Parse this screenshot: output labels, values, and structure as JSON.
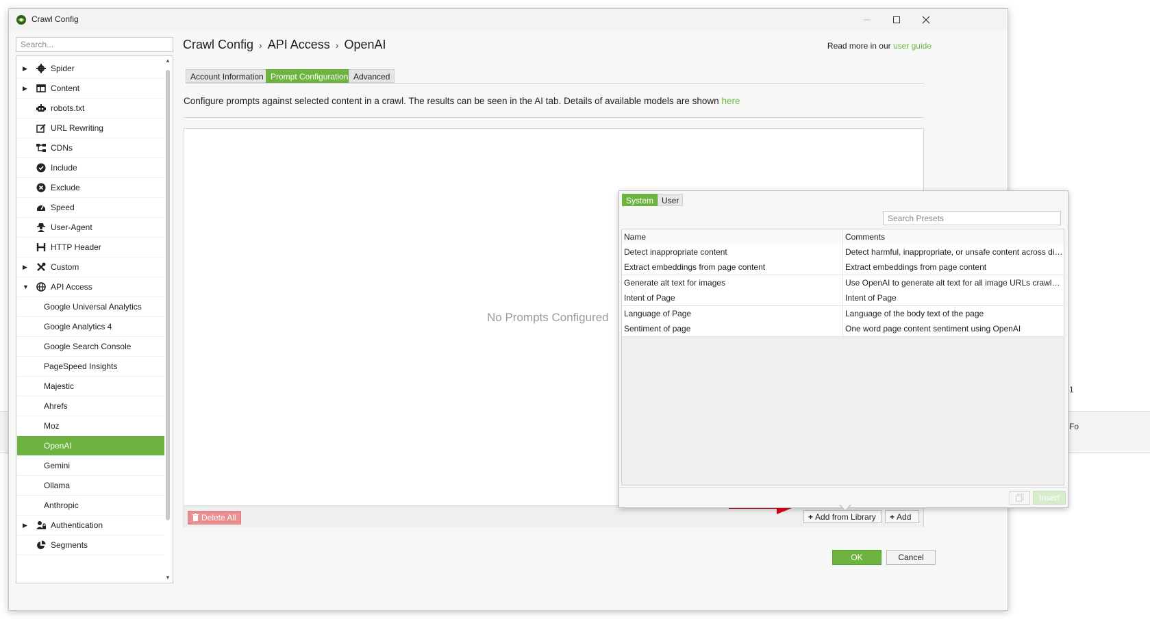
{
  "window": {
    "title": "Crawl Config"
  },
  "sidebar": {
    "search_placeholder": "Search...",
    "items": [
      {
        "label": "Spider",
        "icon": "gear-icon",
        "expandable": true,
        "expanded": false,
        "child": false,
        "selected": false
      },
      {
        "label": "Content",
        "icon": "columns-icon",
        "expandable": true,
        "expanded": false,
        "child": false,
        "selected": false
      },
      {
        "label": "robots.txt",
        "icon": "robot-icon",
        "expandable": false,
        "child": false,
        "selected": false
      },
      {
        "label": "URL Rewriting",
        "icon": "edit-icon",
        "expandable": false,
        "child": false,
        "selected": false
      },
      {
        "label": "CDNs",
        "icon": "network-icon",
        "expandable": false,
        "child": false,
        "selected": false
      },
      {
        "label": "Include",
        "icon": "check-circle-icon",
        "expandable": false,
        "child": false,
        "selected": false
      },
      {
        "label": "Exclude",
        "icon": "x-circle-icon",
        "expandable": false,
        "child": false,
        "selected": false
      },
      {
        "label": "Speed",
        "icon": "gauge-icon",
        "expandable": false,
        "child": false,
        "selected": false
      },
      {
        "label": "User-Agent",
        "icon": "user-secret-icon",
        "expandable": false,
        "child": false,
        "selected": false
      },
      {
        "label": "HTTP Header",
        "icon": "header-icon",
        "expandable": false,
        "child": false,
        "selected": false
      },
      {
        "label": "Custom",
        "icon": "tools-icon",
        "expandable": true,
        "expanded": false,
        "child": false,
        "selected": false
      },
      {
        "label": "API Access",
        "icon": "globe-icon",
        "expandable": true,
        "expanded": true,
        "child": false,
        "selected": false
      },
      {
        "label": "Google Universal Analytics",
        "child": true,
        "selected": false
      },
      {
        "label": "Google Analytics 4",
        "child": true,
        "selected": false
      },
      {
        "label": "Google Search Console",
        "child": true,
        "selected": false
      },
      {
        "label": "PageSpeed Insights",
        "child": true,
        "selected": false
      },
      {
        "label": "Majestic",
        "child": true,
        "selected": false
      },
      {
        "label": "Ahrefs",
        "child": true,
        "selected": false
      },
      {
        "label": "Moz",
        "child": true,
        "selected": false
      },
      {
        "label": "OpenAI",
        "child": true,
        "selected": true
      },
      {
        "label": "Gemini",
        "child": true,
        "selected": false
      },
      {
        "label": "Ollama",
        "child": true,
        "selected": false
      },
      {
        "label": "Anthropic",
        "child": true,
        "selected": false
      },
      {
        "label": "Authentication",
        "icon": "user-lock-icon",
        "expandable": true,
        "expanded": false,
        "child": false,
        "selected": false
      },
      {
        "label": "Segments",
        "icon": "pie-chart-icon",
        "expandable": false,
        "child": false,
        "selected": false
      }
    ]
  },
  "breadcrumb": [
    "Crawl Config",
    "API Access",
    "OpenAI"
  ],
  "read_more": {
    "text": "Read more in our ",
    "link": "user guide"
  },
  "tabs": [
    {
      "label": "Account Information",
      "active": false
    },
    {
      "label": "Prompt Configuration",
      "active": true
    },
    {
      "label": "Advanced",
      "active": false
    }
  ],
  "description": {
    "text": "Configure prompts against selected content in a crawl. The results can be seen in the AI tab. Details of available models are shown ",
    "link": "here"
  },
  "prompts": {
    "empty_message": "No Prompts Configured",
    "delete_all_label": "Delete All",
    "add_from_library_label": "Add from Library",
    "add_label": "Add"
  },
  "dialog_buttons": {
    "ok": "OK",
    "cancel": "Cancel"
  },
  "library_popup": {
    "tabs": [
      {
        "label": "System",
        "active": true
      },
      {
        "label": "User",
        "active": false
      }
    ],
    "search_placeholder": "Search Presets",
    "columns": [
      "Name",
      "Comments"
    ],
    "rows": [
      {
        "name": "Detect inappropriate content",
        "comment": "Detect harmful, inappropriate, or unsafe content across digita..."
      },
      {
        "name": "Extract embeddings from page content",
        "comment": "Extract embeddings from page content"
      },
      {
        "name": "Generate alt text for images",
        "comment": "Use OpenAI to generate alt text for all image URLs crawled..."
      },
      {
        "name": "Intent of Page",
        "comment": "Intent of Page"
      },
      {
        "name": "Language of Page",
        "comment": "Language of the body text of the page"
      },
      {
        "name": "Sentiment of page",
        "comment": "One word page content sentiment using OpenAI"
      }
    ],
    "insert_label": "Insert"
  },
  "colors": {
    "accent": "#6cb33f",
    "danger": "#e88f8f",
    "arrow": "#e3001b"
  }
}
